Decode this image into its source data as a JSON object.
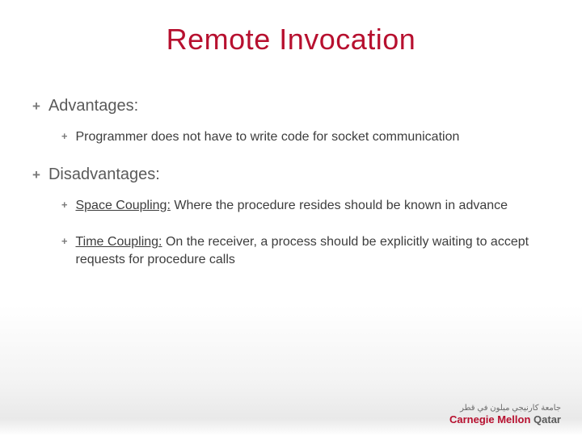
{
  "title": "Remote Invocation",
  "sections": [
    {
      "heading": "Advantages:",
      "items": [
        {
          "term": "",
          "text": "Programmer does not have to write code for socket communication"
        }
      ]
    },
    {
      "heading": "Disadvantages:",
      "items": [
        {
          "term": "Space Coupling:",
          "text": " Where the procedure resides should be known in advance"
        },
        {
          "term": "Time Coupling:",
          "text": " On the receiver, a process should be explicitly waiting to accept requests for procedure calls"
        }
      ]
    }
  ],
  "logo": {
    "arabic": "جامعة كارنيجي ميلون في قطر",
    "en1": "Carnegie Mellon",
    "en2": "Qatar"
  }
}
